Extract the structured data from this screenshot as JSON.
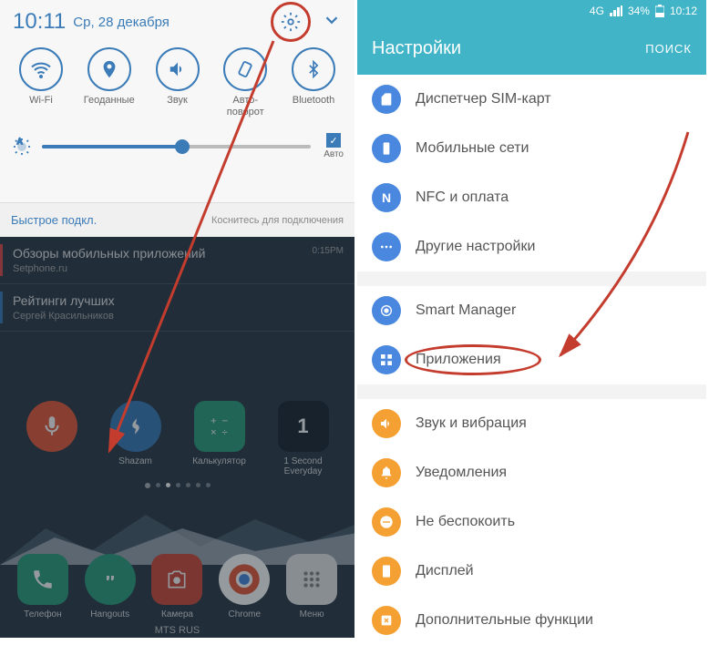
{
  "phone1": {
    "time": "10:11",
    "date": "Ср, 28 декабря",
    "toggles": [
      {
        "label": "Wi-Fi"
      },
      {
        "label": "Геоданные"
      },
      {
        "label": "Звук"
      },
      {
        "label": "Авто-\nповорот"
      },
      {
        "label": "Bluetooth"
      }
    ],
    "auto_label": "Авто",
    "quick_connect": {
      "title": "Быстрое подкл.",
      "hint": "Коснитесь для подключения"
    },
    "notifications": [
      {
        "title": "Обзоры мобильных приложений",
        "sub": "Setphone.ru",
        "time": "0:15PM"
      },
      {
        "title": "Рейтинги лучших",
        "sub": "Сергей Красильников"
      }
    ],
    "apps_mid": [
      {
        "label": ""
      },
      {
        "label": "Shazam"
      },
      {
        "label": "Калькулятор"
      },
      {
        "label": "1 Second\nEveryday"
      }
    ],
    "dock": [
      {
        "label": "Телефон"
      },
      {
        "label": "Hangouts"
      },
      {
        "label": "Камера"
      },
      {
        "label": "Chrome"
      },
      {
        "label": "Меню"
      }
    ],
    "carrier": "MTS RUS"
  },
  "phone2": {
    "status": {
      "signal": "4G",
      "battery": "34%",
      "time": "10:12"
    },
    "header": {
      "title": "Настройки",
      "search": "ПОИСК"
    },
    "items": [
      {
        "label": "Диспетчер SIM-карт",
        "color": "#4a88e0"
      },
      {
        "label": "Мобильные сети",
        "color": "#4a88e0"
      },
      {
        "label": "NFC и оплата",
        "color": "#4a88e0"
      },
      {
        "label": "Другие настройки",
        "color": "#4a88e0"
      },
      {
        "gap": true
      },
      {
        "label": "Smart Manager",
        "color": "#4a88e0"
      },
      {
        "label": "Приложения",
        "color": "#4a88e0",
        "highlight": true
      },
      {
        "gap": true
      },
      {
        "label": "Звук и вибрация",
        "color": "#f5a033"
      },
      {
        "label": "Уведомления",
        "color": "#f5a033"
      },
      {
        "label": "Не беспокоить",
        "color": "#f5a033"
      },
      {
        "label": "Дисплей",
        "color": "#f5a033"
      },
      {
        "label": "Дополнительные функции",
        "color": "#f5a033"
      }
    ]
  }
}
